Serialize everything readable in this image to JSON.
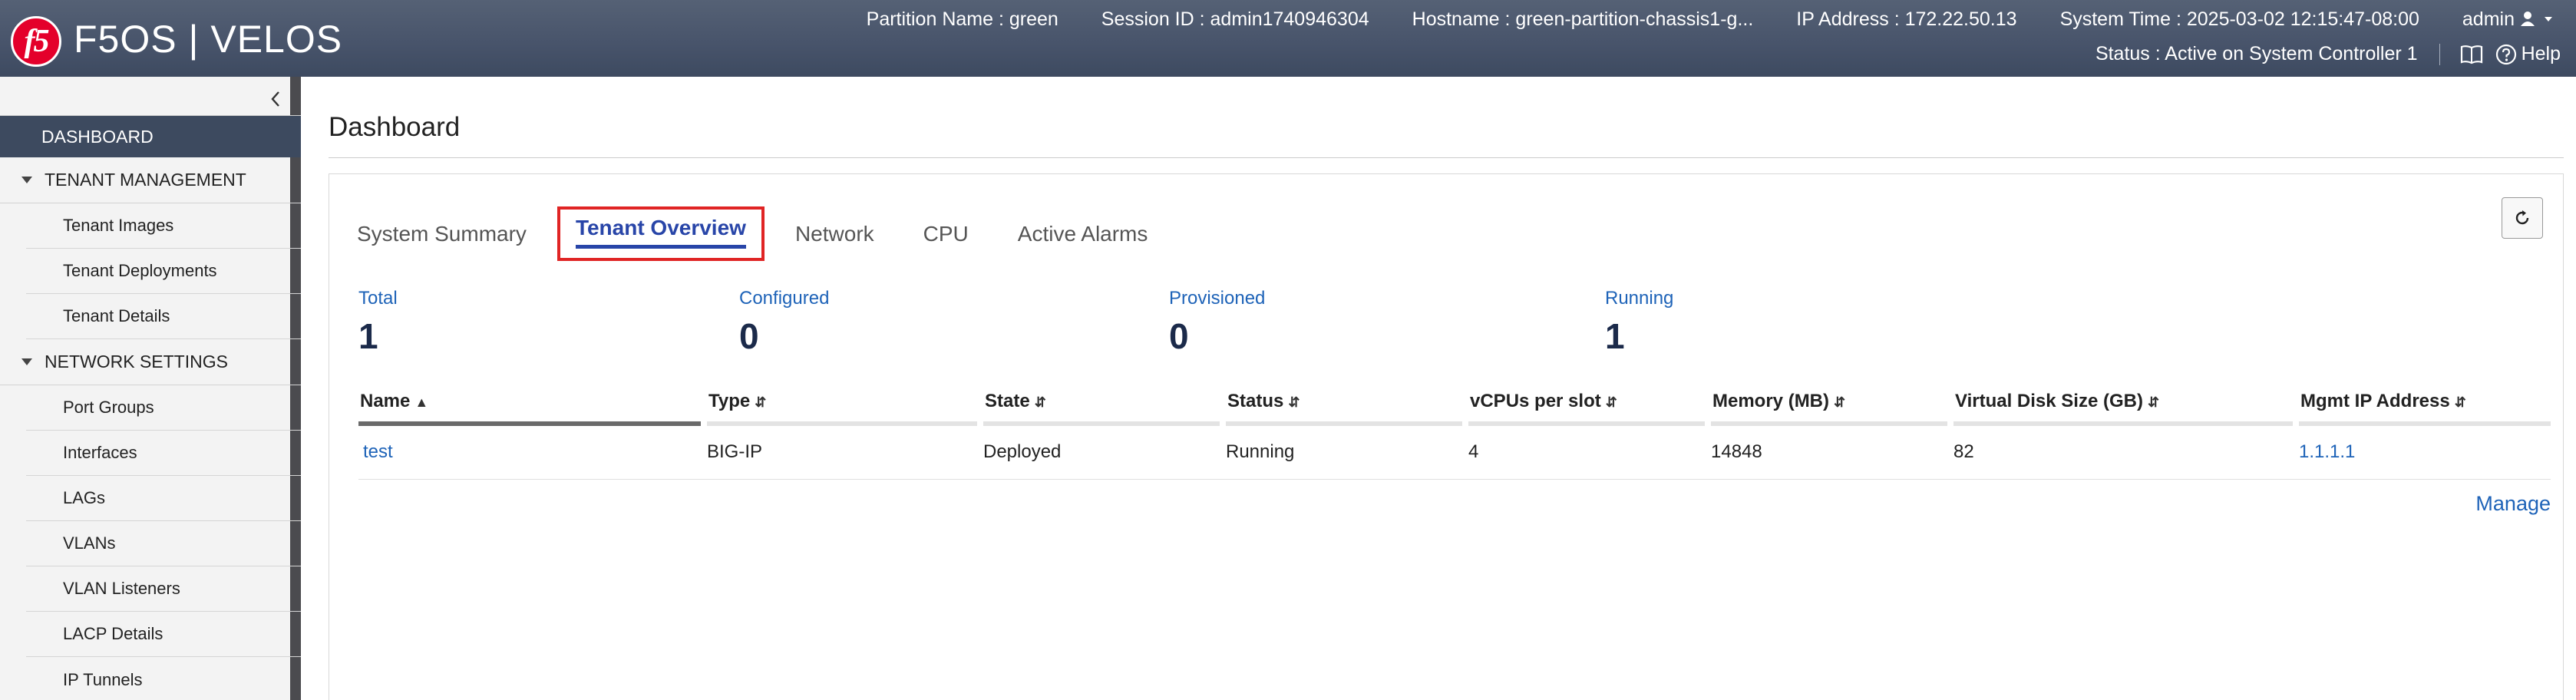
{
  "header": {
    "logo": "f5",
    "product": "F5OS | VELOS",
    "partition": "Partition Name : green",
    "session": "Session ID : admin1740946304",
    "hostname": "Hostname : green-partition-chassis1-g...",
    "ip": "IP Address : 172.22.50.13",
    "system_time": "System Time : 2025-03-02 12:15:47-08:00",
    "user": "admin",
    "status": "Status : Active on System Controller 1",
    "help": "Help"
  },
  "sidebar": {
    "dashboard": "DASHBOARD",
    "tenant_management": {
      "label": "TENANT MANAGEMENT",
      "items": [
        "Tenant Images",
        "Tenant Deployments",
        "Tenant Details"
      ]
    },
    "network_settings": {
      "label": "NETWORK SETTINGS",
      "items": [
        "Port Groups",
        "Interfaces",
        "LAGs",
        "VLANs",
        "VLAN Listeners",
        "LACP Details",
        "IP Tunnels"
      ]
    }
  },
  "main": {
    "title": "Dashboard",
    "tabs": [
      "System Summary",
      "Tenant Overview",
      "Network",
      "CPU",
      "Active Alarms"
    ],
    "active_tab": "Tenant Overview",
    "stats": [
      {
        "label": "Total",
        "value": "1"
      },
      {
        "label": "Configured",
        "value": "0"
      },
      {
        "label": "Provisioned",
        "value": "0"
      },
      {
        "label": "Running",
        "value": "1"
      }
    ],
    "table": {
      "columns": [
        "Name",
        "Type",
        "State",
        "Status",
        "vCPUs per slot",
        "Memory (MB)",
        "Virtual Disk Size (GB)",
        "Mgmt IP Address"
      ],
      "rows": [
        [
          "test",
          "BIG-IP",
          "Deployed",
          "Running",
          "4",
          "14848",
          "82",
          "1.1.1.1"
        ]
      ]
    },
    "manage": "Manage"
  },
  "colors": {
    "header_bg": "#4b566c",
    "sidebar_active": "#3d4a5f",
    "link": "#1e63b8",
    "active_tab": "#2845a8",
    "highlight_box": "#e02424",
    "logo_red": "#e4002b"
  }
}
